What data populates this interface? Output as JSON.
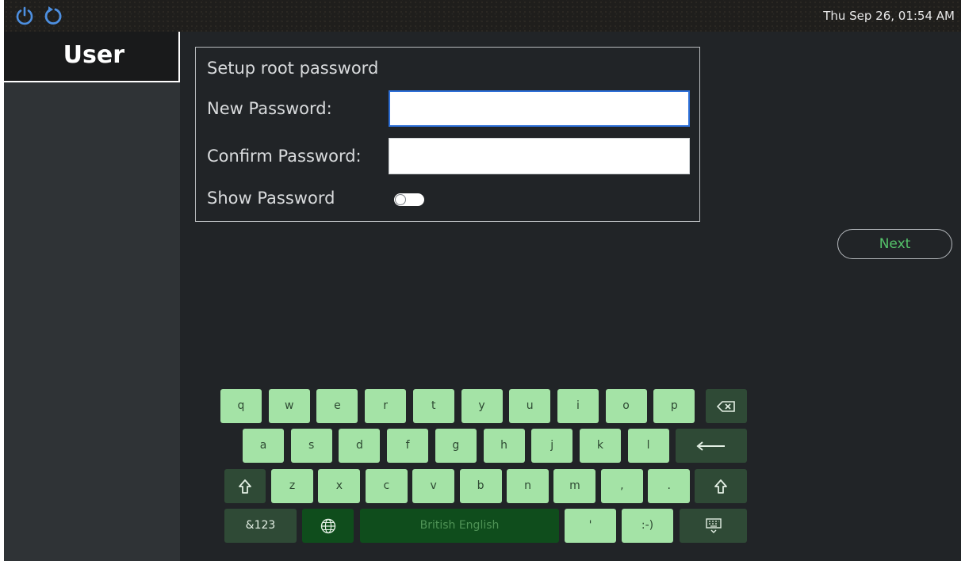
{
  "topbar": {
    "power_icon": "power-icon",
    "restart_icon": "restart-icon",
    "clock": "Thu Sep 26, 01:54 AM"
  },
  "sidebar": {
    "active_item": "User"
  },
  "form": {
    "title": "Setup root password",
    "new_password_label": "New Password:",
    "new_password_value": "",
    "confirm_password_label": "Confirm Password:",
    "confirm_password_value": "",
    "show_password_label": "Show Password",
    "show_password_on": false
  },
  "next_label": "Next",
  "keyboard": {
    "row1": [
      "q",
      "w",
      "e",
      "r",
      "t",
      "y",
      "u",
      "i",
      "o",
      "p"
    ],
    "row2": [
      "a",
      "s",
      "d",
      "f",
      "g",
      "h",
      "j",
      "k",
      "l"
    ],
    "row3": [
      "z",
      "x",
      "c",
      "v",
      "b",
      "n",
      "m",
      ",",
      "."
    ],
    "symbols_label": "&123",
    "space_label": "British English",
    "apostrophe_label": "'",
    "smiley_label": ":-)",
    "icons": [
      "backspace-icon",
      "enter-icon",
      "shift-icon",
      "globe-icon",
      "hide-keyboard-icon"
    ]
  },
  "colors": {
    "accent": "#55c26a",
    "key_light": "#a4e3a6",
    "key_dark": "#2f4a36",
    "focus_border": "#2d6fd8"
  }
}
